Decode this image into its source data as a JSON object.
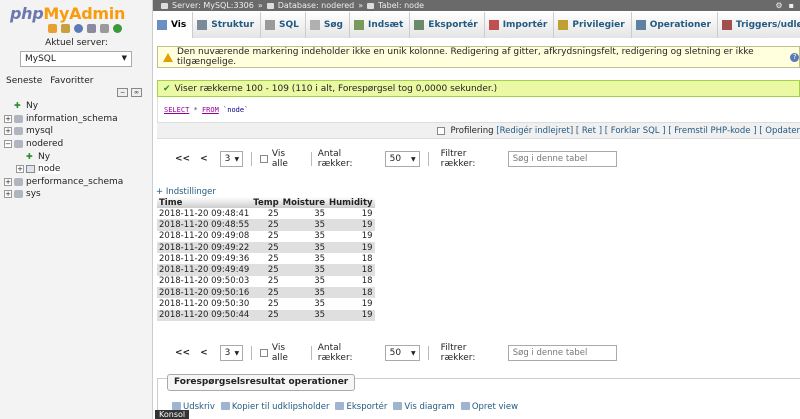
{
  "left": {
    "logo": {
      "php": "php",
      "my": "My",
      "admin": "Admin"
    },
    "server_label": "Aktuel server:",
    "server_value": "MySQL",
    "tabs": [
      "Seneste",
      "Favoritter"
    ],
    "tree": [
      {
        "label": "Ny",
        "kind": "new",
        "level": 0,
        "expander": ""
      },
      {
        "label": "information_schema",
        "kind": "db",
        "level": 0,
        "expander": "+"
      },
      {
        "label": "mysql",
        "kind": "db",
        "level": 0,
        "expander": "+"
      },
      {
        "label": "nodered",
        "kind": "db",
        "level": 0,
        "expander": "−"
      },
      {
        "label": "Ny",
        "kind": "new",
        "level": 1,
        "expander": ""
      },
      {
        "label": "node",
        "kind": "table",
        "level": 1,
        "expander": "+"
      },
      {
        "label": "performance_schema",
        "kind": "db",
        "level": 0,
        "expander": "+"
      },
      {
        "label": "sys",
        "kind": "db",
        "level": 0,
        "expander": "+"
      }
    ]
  },
  "topbar": {
    "server": "Server: MySQL:3306",
    "database": "Database: nodered",
    "table": "Tabel: node"
  },
  "tabs": [
    {
      "label": "Vis",
      "icon": "browse-icon",
      "color": "#6b8fc4"
    },
    {
      "label": "Struktur",
      "icon": "structure-icon",
      "color": "#7a8a9a"
    },
    {
      "label": "SQL",
      "icon": "sql-icon",
      "color": "#9a9a9a"
    },
    {
      "label": "Søg",
      "icon": "search-icon",
      "color": "#b0b0b0"
    },
    {
      "label": "Indsæt",
      "icon": "insert-icon",
      "color": "#7a9a5a"
    },
    {
      "label": "Eksportér",
      "icon": "export-icon",
      "color": "#6a8a6a"
    },
    {
      "label": "Importér",
      "icon": "import-icon",
      "color": "#c05050"
    },
    {
      "label": "Privilegier",
      "icon": "privileges-icon",
      "color": "#c0a030"
    },
    {
      "label": "Operationer",
      "icon": "operations-icon",
      "color": "#6080a0"
    },
    {
      "label": "Triggers/udløsere",
      "icon": "triggers-icon",
      "color": "#a05050"
    }
  ],
  "warning": "Den nuværende markering indeholder ikke en unik kolonne. Redigering af gitter, afkrydsningsfelt, redigering og sletning er ikke tilgængelige.",
  "success": "Viser rækkerne 100 - 109 (110 i alt, Forespørgsel tog 0,0000 sekunder.)",
  "sql": {
    "select": "SELECT",
    "star": "*",
    "from": "FROM",
    "table": "`node`"
  },
  "profiling": {
    "label": "Profilering",
    "links": [
      "[Redigér indlejret]",
      "[ Ret ]",
      "[ Forklar SQL ]",
      "[ Fremstil PHP-kode ]",
      "[ Opdater"
    ]
  },
  "nav": {
    "first": "<<",
    "prev": "<",
    "page": "3",
    "show_all": "Vis alle",
    "rows_label": "Antal rækker:",
    "rows_value": "50",
    "filter_label": "Filtrer rækker:",
    "filter_placeholder": "Søg i denne tabel"
  },
  "table": {
    "options_link": "+ Indstillinger",
    "headers": [
      "Time",
      "Temp",
      "Moisture",
      "Humidity"
    ],
    "rows": [
      [
        "2018-11-20 09:48:41",
        "25",
        "35",
        "19"
      ],
      [
        "2018-11-20 09:48:55",
        "25",
        "35",
        "19"
      ],
      [
        "2018-11-20 09:49:08",
        "25",
        "35",
        "19"
      ],
      [
        "2018-11-20 09:49:22",
        "25",
        "35",
        "19"
      ],
      [
        "2018-11-20 09:49:36",
        "25",
        "35",
        "18"
      ],
      [
        "2018-11-20 09:49:49",
        "25",
        "35",
        "18"
      ],
      [
        "2018-11-20 09:50:03",
        "25",
        "35",
        "18"
      ],
      [
        "2018-11-20 09:50:16",
        "25",
        "35",
        "18"
      ],
      [
        "2018-11-20 09:50:30",
        "25",
        "35",
        "19"
      ],
      [
        "2018-11-20 09:50:44",
        "25",
        "35",
        "19"
      ]
    ]
  },
  "ops": {
    "legend": "Forespørgselsresultat operationer",
    "links": [
      "Udskriv",
      "Kopier til udklipsholder",
      "Eksportér",
      "Vis diagram",
      "Opret view"
    ]
  },
  "console": "Konsol"
}
